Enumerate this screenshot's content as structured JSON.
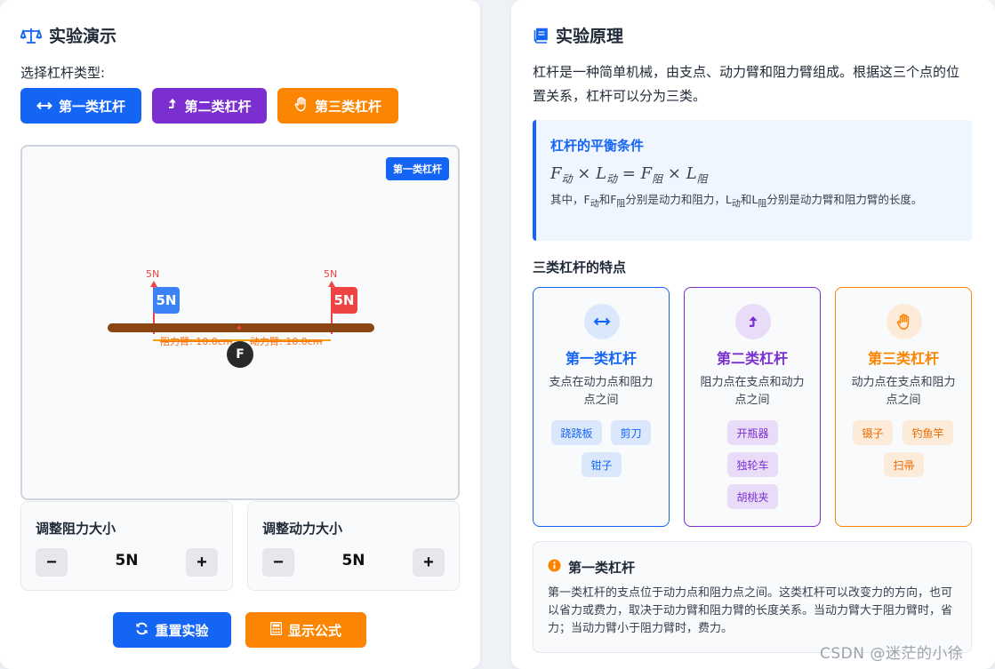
{
  "demo": {
    "title": "实验演示",
    "select_label": "选择杠杆类型:",
    "type_buttons": [
      "第一类杠杆",
      "第二类杠杆",
      "第三类杠杆"
    ],
    "stage_badge": "第一类杠杆",
    "left_force_label": "5N",
    "right_force_label": "5N",
    "left_weight": "5N",
    "right_weight": "5N",
    "resistance_arm_label": "阻力臂: 10.0cm",
    "effort_arm_label": "动力臂: 10.0cm",
    "fulcrum_label": "F",
    "adjust_resistance": {
      "title": "调整阻力大小",
      "value": "5N",
      "minus": "−",
      "plus": "+"
    },
    "adjust_effort": {
      "title": "调整动力大小",
      "value": "5N",
      "minus": "−",
      "plus": "+"
    },
    "reset_button": "重置实验",
    "formula_button": "显示公式"
  },
  "principle": {
    "title": "实验原理",
    "intro": "杠杆是一种简单机械，由支点、动力臂和阻力臂组成。根据这三个点的位置关系，杠杆可以分为三类。",
    "balance": {
      "title": "杠杆的平衡条件",
      "F": "F",
      "L": "L",
      "dong": "动",
      "zu": "阻",
      "times": "×",
      "equals": "=",
      "note_1": "其中，F",
      "note_2": "和F",
      "note_3": "分别是动力和阻力，L",
      "note_4": "和L",
      "note_5": "分别是动力臂和阻力臂的长度。"
    },
    "features_title": "三类杠杆的特点",
    "cards": [
      {
        "title": "第一类杠杆",
        "desc": "支点在动力点和阻力点之间",
        "examples": [
          "跷跷板",
          "剪刀",
          "钳子"
        ],
        "color": "#1565f5",
        "icon": "double-arrow-icon"
      },
      {
        "title": "第二类杠杆",
        "desc": "阻力点在支点和动力点之间",
        "examples": [
          "开瓶器",
          "独轮车",
          "胡桃夹"
        ],
        "color": "#7b2fd0",
        "icon": "level-up-icon"
      },
      {
        "title": "第三类杠杆",
        "desc": "动力点在支点和阻力点之间",
        "examples": [
          "镊子",
          "钓鱼竿",
          "扫帚"
        ],
        "color": "#fb8500",
        "icon": "hand-icon"
      }
    ],
    "info": {
      "title": "第一类杠杆",
      "text": "第一类杠杆的支点位于动力点和阻力点之间。这类杠杆可以改变力的方向，也可以省力或费力，取决于动力臂和阻力臂的长度关系。当动力臂大于阻力臂时，省力；当动力臂小于阻力臂时，费力。"
    }
  },
  "watermark": "CSDN @迷茫的小徐",
  "colors": {
    "blue": "#1565f5",
    "purple": "#7b2fd0",
    "orange": "#fb8500",
    "red": "#ef4444",
    "beam": "#8b4513"
  }
}
